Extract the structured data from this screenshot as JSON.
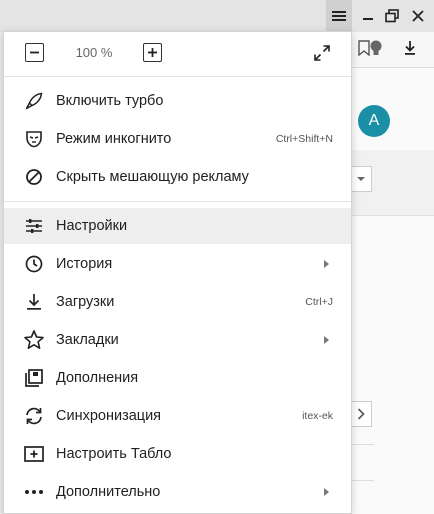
{
  "colors": {
    "accent_avatar": "#1b8fa6",
    "menu_bg": "#ffffff",
    "hover_bg": "#eeeeee",
    "text": "#1f1f1f",
    "hint_text": "#555555"
  },
  "browser": {
    "avatar_letter": "A",
    "window_controls": [
      "menu-icon",
      "minimize-icon",
      "maximize-icon",
      "close-icon"
    ],
    "toolbar_icons": [
      "bookmark-icon",
      "lightbulb-icon",
      "download-icon"
    ]
  },
  "zoom": {
    "value": "100 %",
    "decrease_icon": "minus-icon",
    "increase_icon": "plus-icon",
    "fullscreen_icon": "fullscreen-icon"
  },
  "menu": {
    "turbo": {
      "label": "Включить турбо",
      "icon": "rocket-icon"
    },
    "incognito": {
      "label": "Режим инкогнито",
      "hint": "Ctrl+Shift+N",
      "icon": "incognito-mask-icon"
    },
    "adblock": {
      "label": "Скрыть мешающую рекламу",
      "icon": "block-icon"
    },
    "settings": {
      "label": "Настройки",
      "icon": "settings-sliders-icon"
    },
    "history": {
      "label": "История",
      "icon": "clock-icon",
      "submenu": true
    },
    "downloads": {
      "label": "Загрузки",
      "hint": "Ctrl+J",
      "icon": "download-icon"
    },
    "bookmarks": {
      "label": "Закладки",
      "icon": "star-icon",
      "submenu": true
    },
    "addons": {
      "label": "Дополнения",
      "icon": "addons-icon"
    },
    "sync": {
      "label": "Синхронизация",
      "hint": "itex-ek",
      "icon": "sync-icon"
    },
    "tablo": {
      "label": "Настроить Табло",
      "icon": "add-board-icon"
    },
    "more": {
      "label": "Дополнительно",
      "icon": "more-dots-icon",
      "submenu": true
    }
  }
}
